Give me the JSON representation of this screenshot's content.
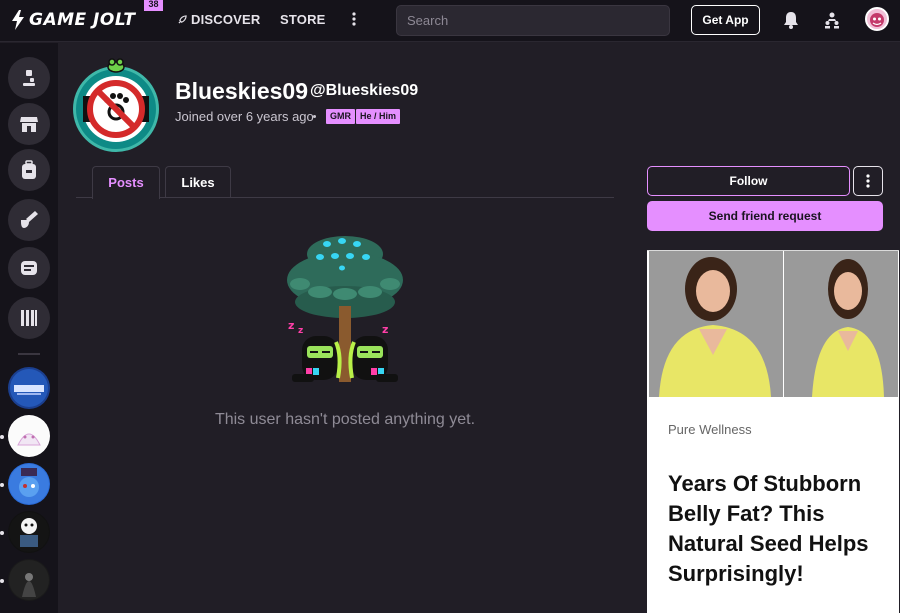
{
  "header": {
    "logo_text": "GAME JOLT",
    "notification_count": "38",
    "nav": {
      "discover": "DISCOVER",
      "store": "STORE"
    },
    "search_placeholder": "Search",
    "get_app": "Get App"
  },
  "profile": {
    "username": "Blueskies09",
    "handle": "@Blueskies09",
    "joined": "Joined over 6 years ago",
    "tags": [
      "GMR",
      "He / Him"
    ]
  },
  "tabs": [
    {
      "label": "Posts",
      "active": true
    },
    {
      "label": "Likes",
      "active": false
    }
  ],
  "empty_state": {
    "message": "This user hasn't posted anything yet."
  },
  "actions": {
    "follow": "Follow",
    "friend_request": "Send friend request"
  },
  "ad": {
    "sponsor": "Pure Wellness",
    "headline": "Years Of Stubborn Belly Fat? This Natural Seed Helps Surprisingly!"
  },
  "colors": {
    "accent": "#e58fff",
    "background": "#211e26",
    "topbar": "#15131a"
  }
}
